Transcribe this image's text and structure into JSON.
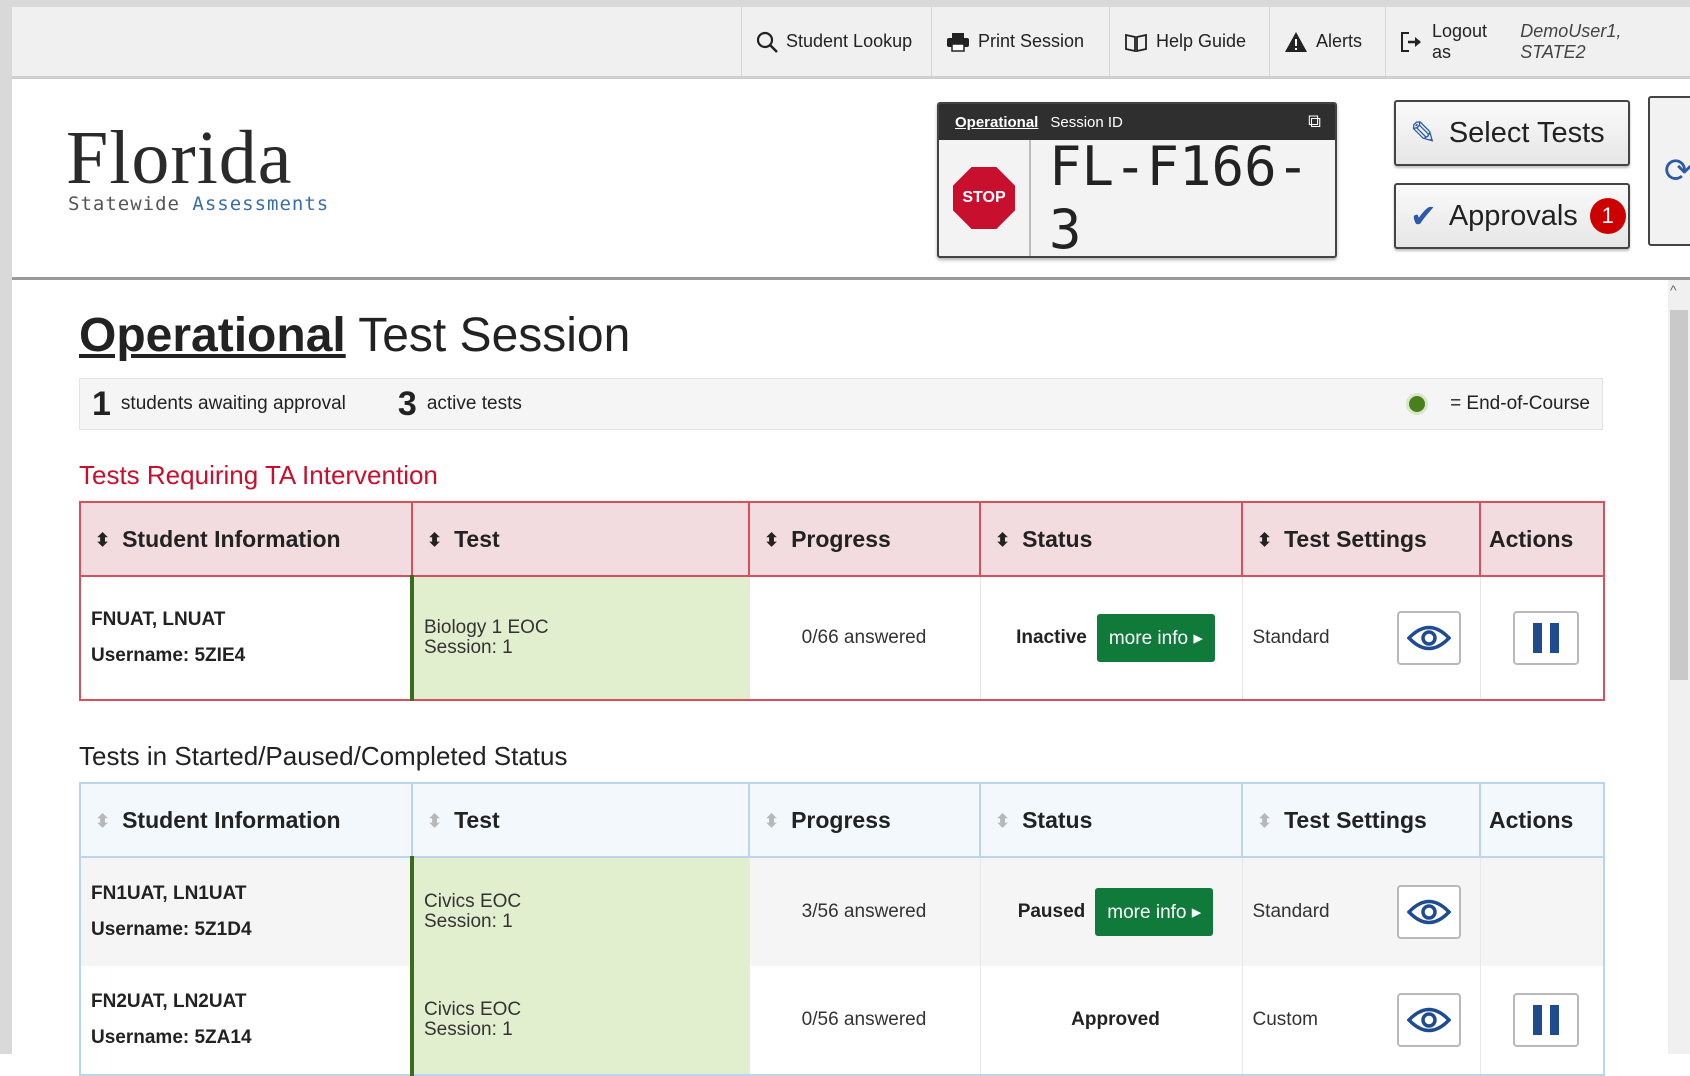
{
  "topbar": {
    "student_lookup": "Student Lookup",
    "print_session": "Print Session",
    "help_guide": "Help Guide",
    "alerts": "Alerts",
    "logout_prefix": "Logout as",
    "logout_user": "DemoUser1, STATE2"
  },
  "logo": {
    "title": "Florida",
    "subtitle_part1": "Statewide",
    "subtitle_part2": "Assessments"
  },
  "session": {
    "type_label": "Operational",
    "id_label": "Session ID",
    "stop_label": "STOP",
    "session_id": "FL-F166-3"
  },
  "header_buttons": {
    "select_tests": "Select Tests",
    "approvals": "Approvals",
    "approvals_count": "1"
  },
  "page": {
    "title_bold": "Operational",
    "title_rest": "Test Session"
  },
  "summary": {
    "awaiting_count": "1",
    "awaiting_label": "students awaiting approval",
    "active_count": "3",
    "active_label": "active tests",
    "eoc_label": "= End-of-Course"
  },
  "columns": {
    "student_info": "Student Information",
    "test": "Test",
    "progress": "Progress",
    "status": "Status",
    "test_settings": "Test Settings",
    "actions": "Actions"
  },
  "intervention": {
    "title": "Tests Requiring TA Intervention",
    "rows": [
      {
        "name": "FNUAT, LNUAT",
        "username": "Username: 5ZIE4",
        "test": "Biology 1 EOC",
        "session": "Session: 1",
        "progress": "0/66 answered",
        "status": "Inactive",
        "more_info": "more info ▸",
        "settings": "Standard"
      }
    ]
  },
  "started": {
    "title": "Tests in Started/Paused/Completed Status",
    "rows": [
      {
        "name": "FN1UAT, LN1UAT",
        "username": "Username: 5Z1D4",
        "test": "Civics EOC",
        "session": "Session: 1",
        "progress": "3/56 answered",
        "status": "Paused",
        "more_info": "more info ▸",
        "settings": "Standard"
      },
      {
        "name": "FN2UAT, LN2UAT",
        "username": "Username: 5ZA14",
        "test": "Civics EOC",
        "session": "Session: 1",
        "progress": "0/56 answered",
        "status": "Approved",
        "settings": "Custom"
      }
    ]
  },
  "colors": {
    "accent_red": "#c8102e",
    "more_info_green": "#0f7a3a",
    "eoc_green": "#4a7f1e",
    "icon_blue": "#1f4c8f"
  }
}
